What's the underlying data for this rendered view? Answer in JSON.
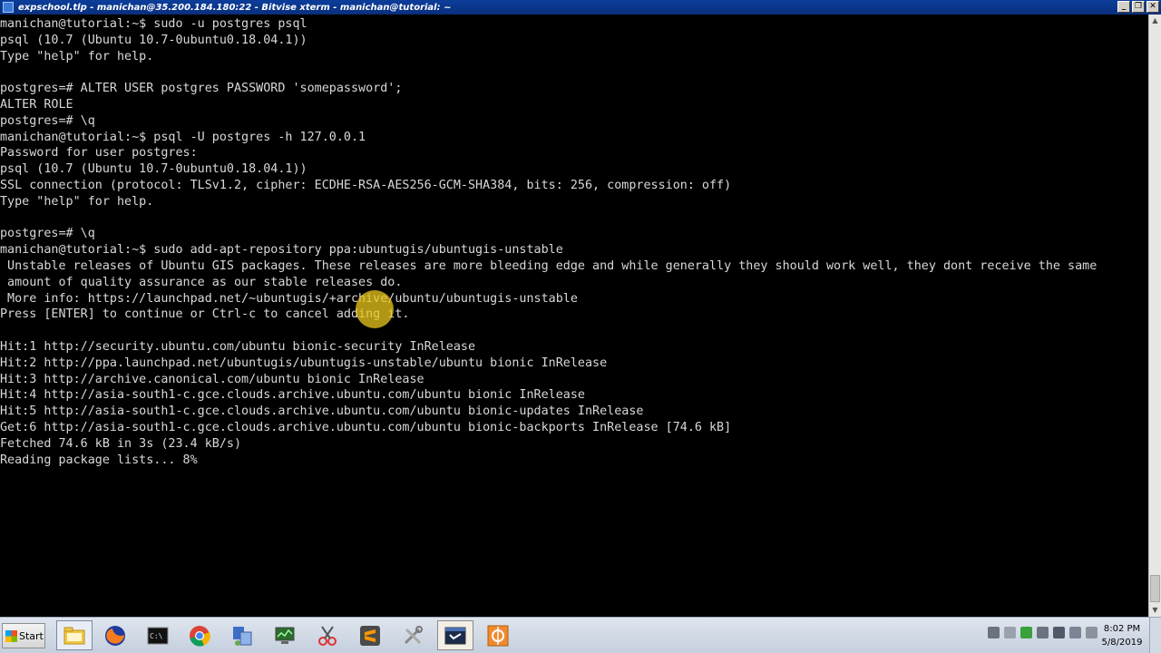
{
  "window": {
    "title": "expschool.tlp - manichan@35.200.184.180:22 - Bitvise xterm - manichan@tutorial: ~",
    "controls": [
      "_",
      "❐",
      "✕"
    ]
  },
  "terminal": {
    "lines": [
      "manichan@tutorial:~$ sudo -u postgres psql",
      "psql (10.7 (Ubuntu 10.7-0ubuntu0.18.04.1))",
      "Type \"help\" for help.",
      "",
      "postgres=# ALTER USER postgres PASSWORD 'somepassword';",
      "ALTER ROLE",
      "postgres=# \\q",
      "manichan@tutorial:~$ psql -U postgres -h 127.0.0.1",
      "Password for user postgres:",
      "psql (10.7 (Ubuntu 10.7-0ubuntu0.18.04.1))",
      "SSL connection (protocol: TLSv1.2, cipher: ECDHE-RSA-AES256-GCM-SHA384, bits: 256, compression: off)",
      "Type \"help\" for help.",
      "",
      "postgres=# \\q",
      "manichan@tutorial:~$ sudo add-apt-repository ppa:ubuntugis/ubuntugis-unstable",
      " Unstable releases of Ubuntu GIS packages. These releases are more bleeding edge and while generally they should work well, they dont receive the same",
      " amount of quality assurance as our stable releases do.",
      " More info: https://launchpad.net/~ubuntugis/+archive/ubuntu/ubuntugis-unstable",
      "Press [ENTER] to continue or Ctrl-c to cancel adding it.",
      "",
      "Hit:1 http://security.ubuntu.com/ubuntu bionic-security InRelease",
      "Hit:2 http://ppa.launchpad.net/ubuntugis/ubuntugis-unstable/ubuntu bionic InRelease",
      "Hit:3 http://archive.canonical.com/ubuntu bionic InRelease",
      "Hit:4 http://asia-south1-c.gce.clouds.archive.ubuntu.com/ubuntu bionic InRelease",
      "Hit:5 http://asia-south1-c.gce.clouds.archive.ubuntu.com/ubuntu bionic-updates InRelease",
      "Get:6 http://asia-south1-c.gce.clouds.archive.ubuntu.com/ubuntu bionic-backports InRelease [74.6 kB]",
      "Fetched 74.6 kB in 3s (23.4 kB/s)",
      "Reading package lists... 8%"
    ]
  },
  "taskbar": {
    "start_label": "Start",
    "icons": [
      "file-explorer-icon",
      "firefox-icon",
      "command-prompt-icon",
      "chrome-icon",
      "network-connections-icon",
      "terminal-monitor-icon",
      "snipping-tool-icon",
      "sublime-text-icon",
      "tools-icon",
      "bitvise-xterm-icon",
      "bitvise-client-icon"
    ],
    "clock_time": "8:02 PM",
    "clock_date": "5/8/2019"
  },
  "colors": {
    "terminal_bg": "#000000",
    "terminal_fg": "#d8d8d8",
    "titlebar": "#0b3d9a",
    "highlight": "#ecc81e"
  }
}
